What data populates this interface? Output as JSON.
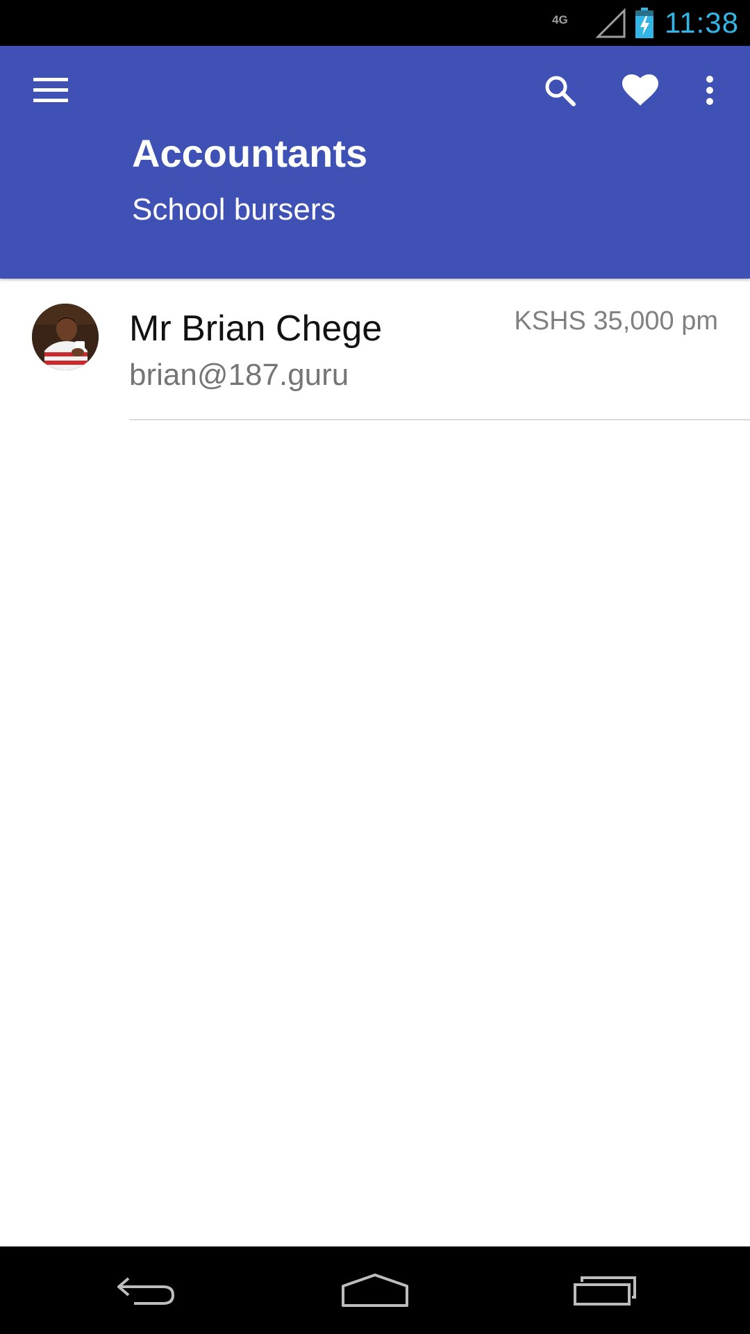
{
  "status_bar": {
    "network": "4G",
    "time": "11:38",
    "icons": [
      "signal-icon",
      "battery-charging-icon"
    ]
  },
  "toolbar": {
    "title": "Accountants",
    "subtitle": "School bursers",
    "icons": [
      "menu-icon",
      "search-icon",
      "heart-icon",
      "more-vert-icon"
    ]
  },
  "list": {
    "items": [
      {
        "name": "Mr Brian Chege",
        "email": "brian@187.guru",
        "salary": "KSHS 35,000 pm"
      }
    ]
  },
  "nav_bar": {
    "icons": [
      "back-icon",
      "home-icon",
      "recents-icon"
    ]
  },
  "colors": {
    "primary": "#3f51b5",
    "status_clock": "#33b5e5",
    "secondary_text": "#757575"
  }
}
